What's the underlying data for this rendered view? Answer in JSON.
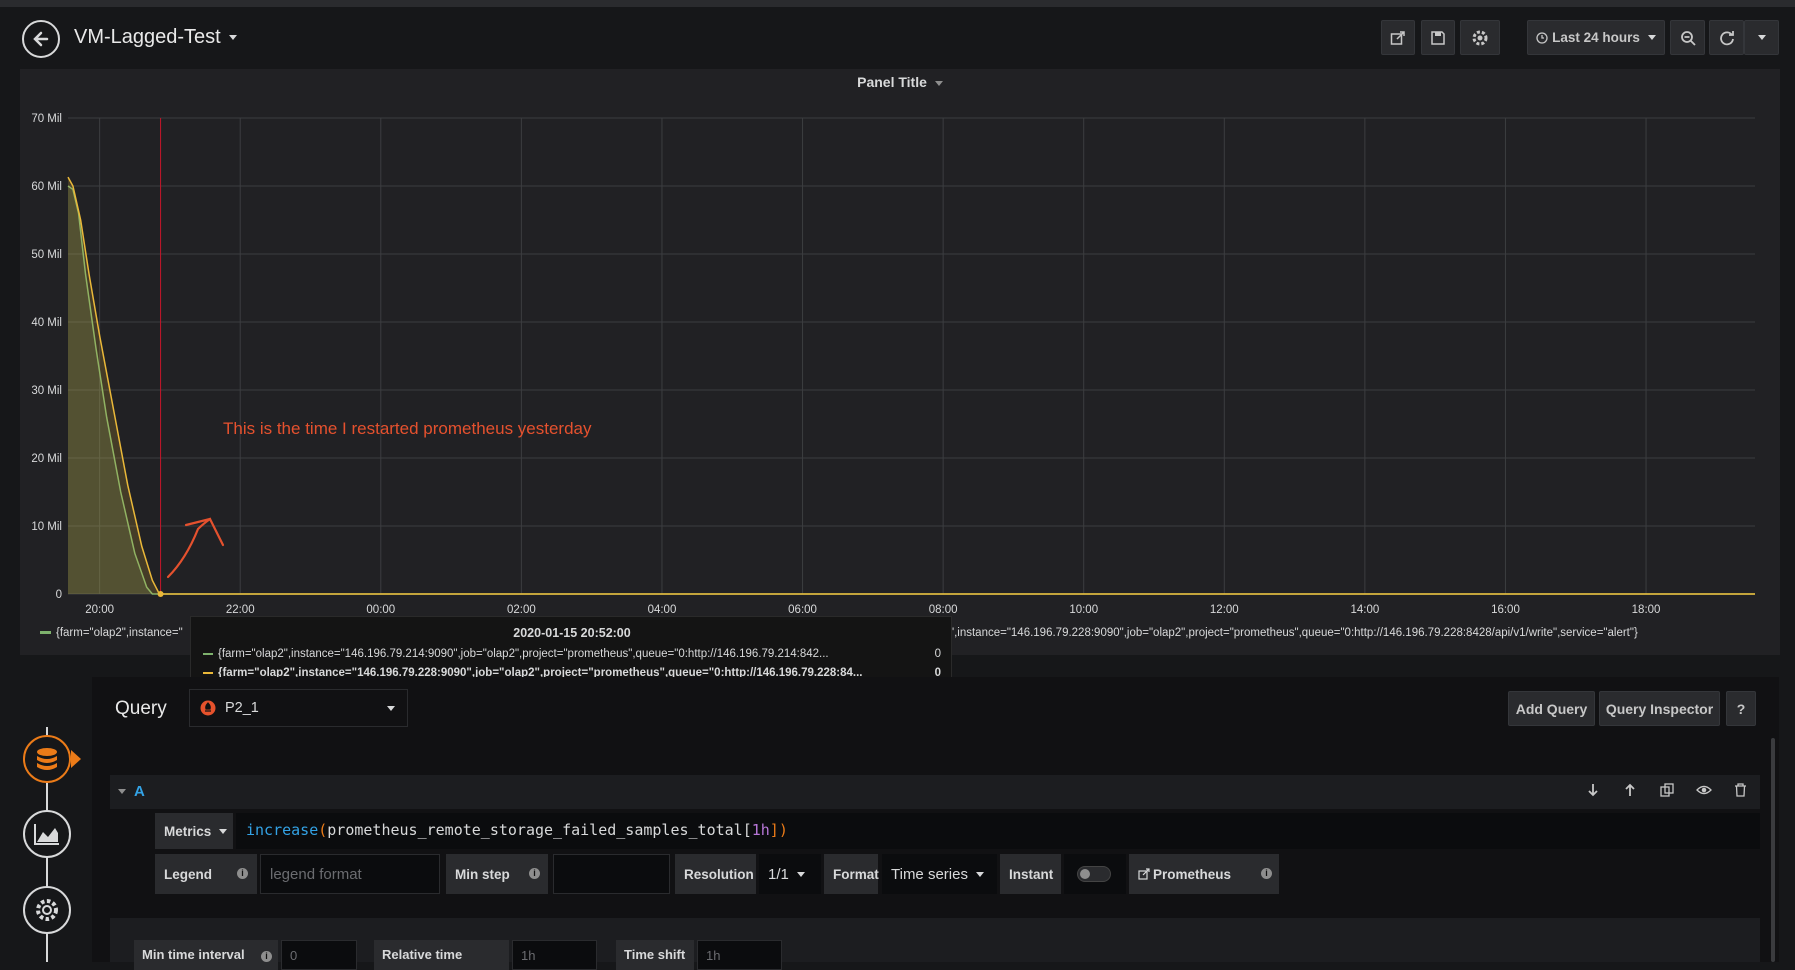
{
  "header": {
    "title": "VM-Lagged-Test",
    "time_range": "Last 24 hours"
  },
  "panel": {
    "title": "Panel Title",
    "annotation_text": "This is the time I restarted prometheus yesterday",
    "legend": {
      "item1": "{farm=\"olap2\",instance=\"",
      "item2_tail": "\",instance=\"146.196.79.228:9090\",job=\"olap2\",project=\"prometheus\",queue=\"0:http://146.196.79.228:8428/api/v1/write\",service=\"alert\"}"
    },
    "tooltip": {
      "time": "2020-01-15 20:52:00",
      "rows": [
        {
          "label": "{farm=\"olap2\",instance=\"146.196.79.214:9090\",job=\"olap2\",project=\"prometheus\",queue=\"0:http://146.196.79.214:842...",
          "value": "0",
          "color": "#7eb26d"
        },
        {
          "label": "{farm=\"olap2\",instance=\"146.196.79.228:9090\",job=\"olap2\",project=\"prometheus\",queue=\"0:http://146.196.79.228:84...",
          "value": "0",
          "color": "#eab839"
        }
      ]
    }
  },
  "chart_data": {
    "type": "line",
    "y_ticks": [
      "0",
      "10 Mil",
      "20 Mil",
      "30 Mil",
      "40 Mil",
      "50 Mil",
      "60 Mil",
      "70 Mil"
    ],
    "x_ticks": [
      "20:00",
      "22:00",
      "00:00",
      "02:00",
      "04:00",
      "06:00",
      "08:00",
      "10:00",
      "12:00",
      "14:00",
      "16:00",
      "18:00"
    ],
    "ylim": [
      0,
      70
    ],
    "xlim_hours": [
      19.55,
      43.55
    ],
    "annotation_hour": 20.867,
    "series": [
      {
        "color": "#7eb26d",
        "points": [
          [
            19.55,
            60
          ],
          [
            19.62,
            59.5
          ],
          [
            19.7,
            56
          ],
          [
            19.8,
            47
          ],
          [
            19.95,
            36
          ],
          [
            20.1,
            26
          ],
          [
            20.3,
            15
          ],
          [
            20.5,
            6
          ],
          [
            20.67,
            1
          ],
          [
            20.75,
            0
          ],
          [
            43.55,
            0
          ]
        ]
      },
      {
        "color": "#eab839",
        "points": [
          [
            19.55,
            61.3
          ],
          [
            19.62,
            60
          ],
          [
            19.73,
            55
          ],
          [
            19.85,
            47
          ],
          [
            20.0,
            38
          ],
          [
            20.2,
            27
          ],
          [
            20.4,
            16
          ],
          [
            20.6,
            7
          ],
          [
            20.75,
            2
          ],
          [
            20.85,
            0
          ],
          [
            43.55,
            0
          ]
        ]
      }
    ]
  },
  "query": {
    "label": "Query",
    "datasource": "P2_1",
    "add_query": "Add Query",
    "inspector": "Query Inspector",
    "help": "?",
    "row_letter": "A",
    "metrics_label": "Metrics",
    "expr_fn": "increase",
    "expr_paren_open": "(",
    "expr_metric": "prometheus_remote_storage_failed_samples_total",
    "expr_bracket_open": "[",
    "expr_range": "1h",
    "expr_close": "])",
    "legend_label": "Legend",
    "legend_placeholder": "legend format",
    "min_step_label": "Min step",
    "resolution_label": "Resolution",
    "resolution_value": "1/1",
    "format_label": "Format",
    "format_value": "Time series",
    "instant_label": "Instant",
    "prometheus_link": "Prometheus",
    "min_interval_label": "Min time interval",
    "min_interval_placeholder": "0",
    "relative_time_label": "Relative time",
    "relative_time_placeholder": "1h",
    "time_shift_label": "Time shift",
    "time_shift_placeholder": "1h"
  }
}
